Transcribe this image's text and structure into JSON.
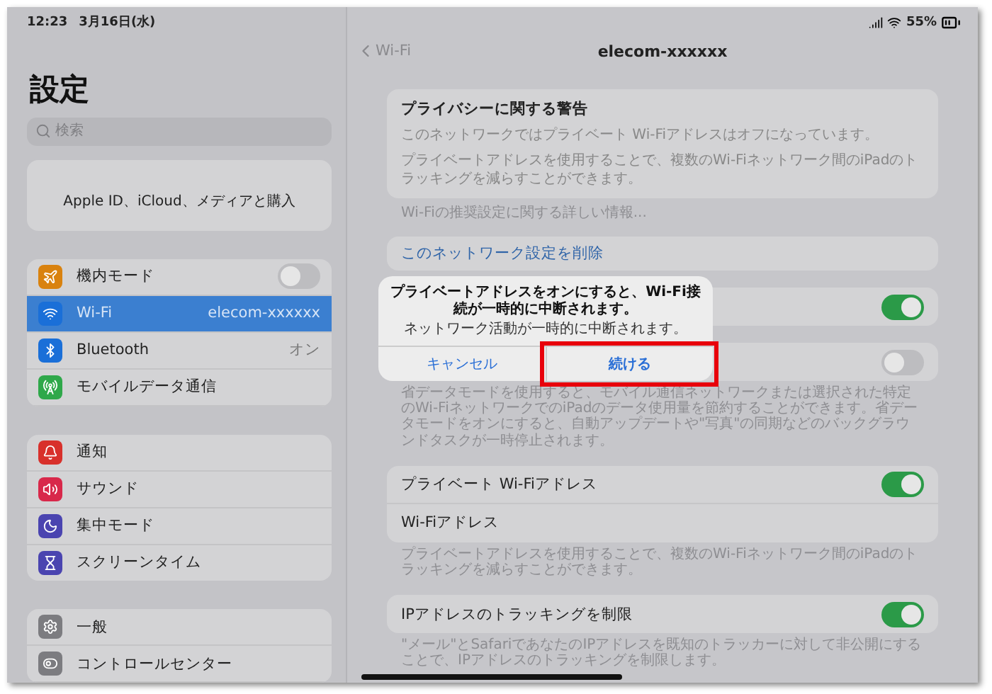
{
  "status_bar": {
    "time": "12:23",
    "date": "3月16日(水)",
    "battery": "55%"
  },
  "sidebar": {
    "title": "設定",
    "search": {
      "placeholder": "検索"
    },
    "account": {
      "text": "Apple ID、iCloud、メディアと購入"
    },
    "groups": [
      {
        "items": [
          {
            "label": "機内モード",
            "color": "#d9820f",
            "kind": "toggle",
            "on": false,
            "selected": false
          },
          {
            "label": "Wi-Fi",
            "value": "elecom-xxxxxx",
            "color": "#1a6fd8",
            "kind": "value",
            "selected": true
          },
          {
            "label": "Bluetooth",
            "value": "オン",
            "color": "#1a6fd8",
            "kind": "value",
            "selected": false
          },
          {
            "label": "モバイルデータ通信",
            "color": "#2fa84a",
            "kind": "plain",
            "selected": false
          }
        ]
      },
      {
        "items": [
          {
            "label": "通知",
            "color": "#d8302b",
            "kind": "plain",
            "selected": false
          },
          {
            "label": "サウンド",
            "color": "#d8284a",
            "kind": "plain",
            "selected": false
          },
          {
            "label": "集中モード",
            "color": "#4a44b0",
            "kind": "plain",
            "selected": false
          },
          {
            "label": "スクリーンタイム",
            "color": "#4a44b0",
            "kind": "plain",
            "selected": false
          }
        ]
      },
      {
        "items": [
          {
            "label": "一般",
            "color": "#7c7c80",
            "kind": "plain",
            "selected": false
          },
          {
            "label": "コントロールセンター",
            "color": "#7c7c80",
            "kind": "plain",
            "selected": false
          }
        ]
      }
    ]
  },
  "nav": {
    "back": "Wi-Fi",
    "title": "elecom-xxxxxx"
  },
  "warning": {
    "title": "プライバシーに関する警告",
    "lines": [
      "このネットワークではプライベート Wi-Fiアドレスはオフになっています。",
      "プライベートアドレスを使用することで、複数のWi-Fiネットワーク間のiPadのトラッキングを減らすことができます。"
    ],
    "link": "Wi-Fiの推奨設定に関する詳しい情報..."
  },
  "forget": {
    "label": "このネットワーク設定を削除"
  },
  "sections": [
    {
      "rows": [
        {
          "on": true
        }
      ]
    },
    {
      "rows": [
        {
          "on": false
        }
      ],
      "footer": "省データモードを使用すると、モバイル通信ネットワークまたは選択された特定のWi-FiネットワークでのiPadのデータ使用量を節約することができます。省データモードをオンにすると、自動アップデートや\"写真\"の同期などのバックグラウンドタスクが一時停止されます。"
    },
    {
      "rows": [
        {
          "label": "プライベート Wi-Fiアドレス",
          "kind": "toggle",
          "on": true
        },
        {
          "label": "Wi-Fiアドレス",
          "kind": "plain"
        }
      ],
      "footer": "プライベートアドレスを使用することで、複数のWi-Fiネットワーク間のiPadのトラッキングを減らすことができます。"
    },
    {
      "rows": [
        {
          "label": "IPアドレスのトラッキングを制限",
          "kind": "toggle",
          "on": true
        }
      ],
      "footer": "\"メール\"とSafariであなたのIPアドレスを既知のトラッカーに対して非公開にすることで、IPアドレスのトラッキングを制限します。"
    }
  ],
  "dialog": {
    "title": "プライベートアドレスをオンにすると、Wi-Fi接続が一時的に中断されます。",
    "message": "ネットワーク活動が一時的に中断されます。",
    "buttons": [
      {
        "label": "キャンセル",
        "highlighted": false
      },
      {
        "label": "続ける",
        "highlighted": true
      }
    ]
  }
}
